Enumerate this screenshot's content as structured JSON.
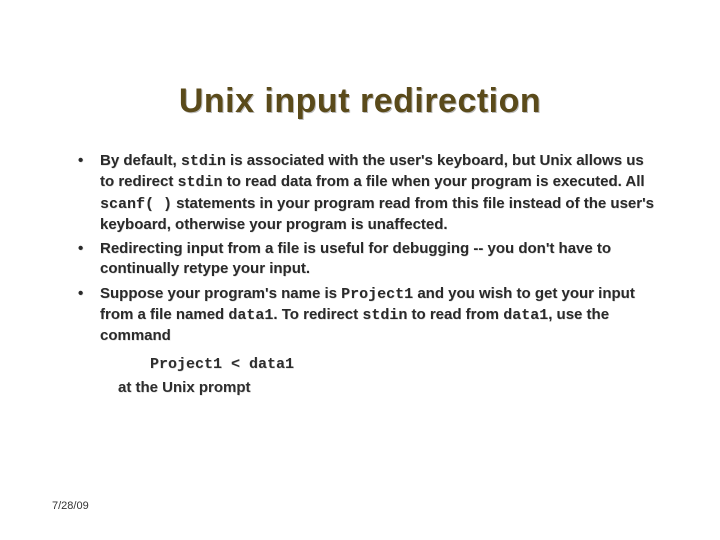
{
  "title": "Unix input redirection",
  "bullets": {
    "b1": {
      "t1": "By default, ",
      "code1": "stdin",
      "t2": " is associated with the user's keyboard, but Unix allows us to redirect ",
      "code2": "stdin",
      "t3": " to read data from a file when your program is executed.  All ",
      "code3": "scanf( )",
      "t4": " statements in your program read from this file instead of the user's keyboard, otherwise your program is unaffected."
    },
    "b2": "Redirecting input from a file is useful for debugging -- you don't have to continually retype your input.",
    "b3": {
      "t1": "Suppose your program's name is ",
      "code1": "Project1",
      "t2": " and you wish to get your input from a file named ",
      "code2": "data1",
      "t3": ".  To redirect ",
      "code3": "stdin",
      "t4": " to read from ",
      "code4": "data1",
      "t5": ", use the command"
    }
  },
  "command": "Project1 < data1",
  "trailer": "at the Unix prompt",
  "footer_date": "7/28/09"
}
